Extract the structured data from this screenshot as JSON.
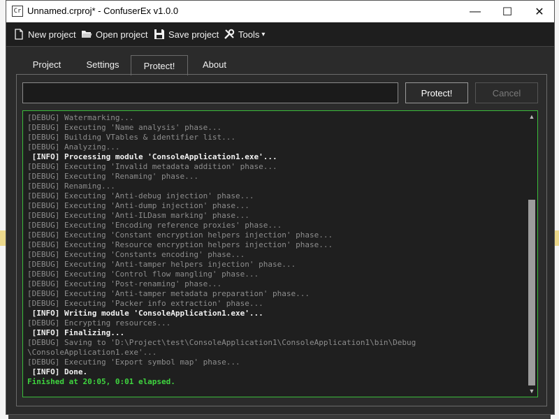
{
  "window": {
    "title": "Unnamed.crproj* - ConfuserEx v1.0.0",
    "icon_text": "Cr",
    "controls": {
      "minimize": "—",
      "maximize": "☐",
      "close": "✕"
    }
  },
  "toolbar": {
    "new_label": "New project",
    "open_label": "Open project",
    "save_label": "Save project",
    "tools_label": "Tools",
    "tools_arrow": "▾"
  },
  "tabs": [
    {
      "label": "Project"
    },
    {
      "label": "Settings"
    },
    {
      "label": "Protect!",
      "active": true
    },
    {
      "label": "About"
    }
  ],
  "protect": {
    "input_value": "",
    "protect_label": "Protect!",
    "cancel_label": "Cancel"
  },
  "log": [
    {
      "level": "debug",
      "text": "[DEBUG] Watermarking..."
    },
    {
      "level": "debug",
      "text": "[DEBUG] Executing 'Name analysis' phase..."
    },
    {
      "level": "debug",
      "text": "[DEBUG] Building VTables & identifier list..."
    },
    {
      "level": "debug",
      "text": "[DEBUG] Analyzing..."
    },
    {
      "level": "info",
      "text": " [INFO] Processing module 'ConsoleApplication1.exe'..."
    },
    {
      "level": "debug",
      "text": "[DEBUG] Executing 'Invalid metadata addition' phase..."
    },
    {
      "level": "debug",
      "text": "[DEBUG] Executing 'Renaming' phase..."
    },
    {
      "level": "debug",
      "text": "[DEBUG] Renaming..."
    },
    {
      "level": "debug",
      "text": "[DEBUG] Executing 'Anti-debug injection' phase..."
    },
    {
      "level": "debug",
      "text": "[DEBUG] Executing 'Anti-dump injection' phase..."
    },
    {
      "level": "debug",
      "text": "[DEBUG] Executing 'Anti-ILDasm marking' phase..."
    },
    {
      "level": "debug",
      "text": "[DEBUG] Executing 'Encoding reference proxies' phase..."
    },
    {
      "level": "debug",
      "text": "[DEBUG] Executing 'Constant encryption helpers injection' phase..."
    },
    {
      "level": "debug",
      "text": "[DEBUG] Executing 'Resource encryption helpers injection' phase..."
    },
    {
      "level": "debug",
      "text": "[DEBUG] Executing 'Constants encoding' phase..."
    },
    {
      "level": "debug",
      "text": "[DEBUG] Executing 'Anti-tamper helpers injection' phase..."
    },
    {
      "level": "debug",
      "text": "[DEBUG] Executing 'Control flow mangling' phase..."
    },
    {
      "level": "debug",
      "text": "[DEBUG] Executing 'Post-renaming' phase..."
    },
    {
      "level": "debug",
      "text": "[DEBUG] Executing 'Anti-tamper metadata preparation' phase..."
    },
    {
      "level": "debug",
      "text": "[DEBUG] Executing 'Packer info extraction' phase..."
    },
    {
      "level": "info",
      "text": " [INFO] Writing module 'ConsoleApplication1.exe'..."
    },
    {
      "level": "debug",
      "text": "[DEBUG] Encrypting resources..."
    },
    {
      "level": "info",
      "text": " [INFO] Finalizing..."
    },
    {
      "level": "debug",
      "text": "[DEBUG] Saving to 'D:\\Project\\test\\ConsoleApplication1\\ConsoleApplication1\\bin\\Debug"
    },
    {
      "level": "debug",
      "text": "\\ConsoleApplication1.exe'..."
    },
    {
      "level": "debug",
      "text": "[DEBUG] Executing 'Export symbol map' phase..."
    },
    {
      "level": "info",
      "text": " [INFO] Done."
    },
    {
      "level": "done",
      "text": "Finished at 20:05, 0:01 elapsed."
    }
  ],
  "colors": {
    "log_border": "#3bbd3b",
    "debug_text": "#8d8d8d",
    "info_text": "#f2f2f2",
    "finished_text": "#3fd43f"
  },
  "scrollbar": {
    "up_arrow": "▲",
    "down_arrow": "▼"
  }
}
